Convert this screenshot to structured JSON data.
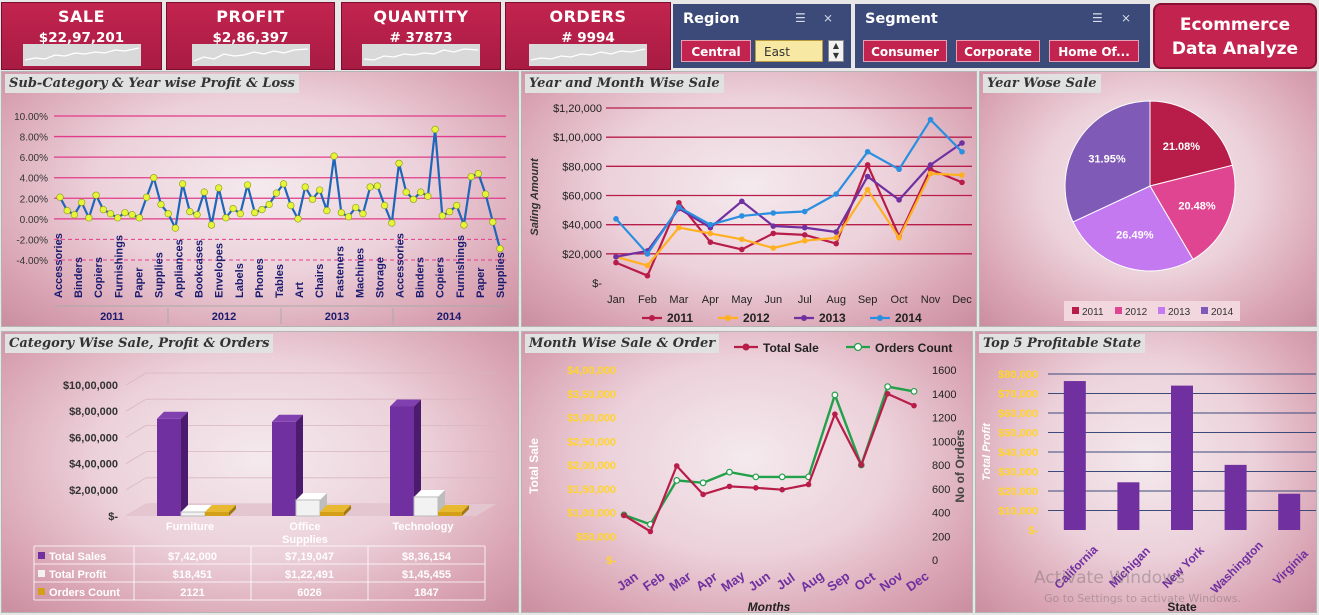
{
  "kpis": [
    {
      "title": "SALE",
      "value": "$22,97,201"
    },
    {
      "title": "PROFIT",
      "value": "$2,86,397"
    },
    {
      "title": "QUANTITY",
      "value": "# 37873"
    },
    {
      "title": "ORDERS",
      "value": "# 9994"
    }
  ],
  "region_slicer": {
    "title": "Region",
    "items": [
      "Central",
      "East"
    ],
    "selected": "Central"
  },
  "segment_slicer": {
    "title": "Segment",
    "items": [
      "Consumer",
      "Corporate",
      "Home Of..."
    ]
  },
  "dashboard_title": "Ecommerce Data Analyze",
  "panels": {
    "subcat": "Sub-Category & Year wise Profit & Loss",
    "yearmonth": "Year and Month Wise Sale",
    "yearpie": "Year Wose Sale",
    "category": "Category Wise Sale, Profit & Orders",
    "monthwise": "Month Wise Sale & Order",
    "top5": "Top 5 Profitable State"
  },
  "watermark": {
    "line1": "Activate Windows",
    "line2": "Go to Settings to activate Windows."
  },
  "colors": {
    "accent": "#c2244f",
    "slicer": "#3c4a7a",
    "purple": "#7030a0",
    "y2011": "#b81d4a",
    "y2012": "#ffb020",
    "y2013": "#7030a0",
    "y2014": "#2a8fe0"
  },
  "chart_data": [
    {
      "type": "line",
      "title": "Sub-Category & Year wise Profit & Loss",
      "ylim": [
        -0.04,
        0.1
      ],
      "yticks": [
        "10.00%",
        "8.00%",
        "6.00%",
        "4.00%",
        "2.00%",
        "0.00%",
        "-2.00%",
        "-4.00%"
      ],
      "x_labels": [
        "Accessories",
        "Binders",
        "Copiers",
        "Furnishings",
        "Paper",
        "Supplies",
        "Appliances",
        "Bookcases",
        "Envelopes",
        "Labels",
        "Phones",
        "Tables",
        "Art",
        "Chairs",
        "Fasteners",
        "Machines",
        "Storage",
        "Accessories",
        "Binders",
        "Copiers",
        "Furnishings",
        "Paper",
        "Supplies"
      ],
      "years": [
        "2011",
        "2012",
        "2013",
        "2014"
      ],
      "values": [
        0.021,
        0.008,
        0.004,
        0.016,
        0.001,
        0.023,
        0.009,
        0.005,
        0.001,
        0.006,
        0.004,
        0.001,
        0.021,
        0.04,
        0.014,
        0.005,
        -0.009,
        0.034,
        0.007,
        0.004,
        0.026,
        -0.006,
        0.03,
        0.001,
        0.01,
        0.005,
        0.033,
        0.006,
        0.009,
        0.014,
        0.025,
        0.034,
        0.013,
        0.0,
        0.031,
        0.019,
        0.028,
        0.008,
        0.061,
        0.006,
        0.002,
        0.011,
        0.005,
        0.031,
        0.032,
        0.013,
        -0.004,
        0.054,
        0.026,
        0.019,
        0.026,
        0.022,
        0.087,
        0.003,
        0.007,
        0.013,
        -0.006,
        0.041,
        0.044,
        0.024,
        -0.003,
        -0.029
      ]
    },
    {
      "type": "line",
      "title": "Year and Month Wise Sale",
      "ylabel": "Saling Amount",
      "ylim": [
        0,
        120000
      ],
      "yticks": [
        "$1,20,000",
        "$1,00,000",
        "$80,000",
        "$60,000",
        "$40,000",
        "$20,000",
        "$-"
      ],
      "categories": [
        "Jan",
        "Feb",
        "Mar",
        "Apr",
        "May",
        "Jun",
        "Jul",
        "Aug",
        "Sep",
        "Oct",
        "Nov",
        "Dec"
      ],
      "series": [
        {
          "name": "2011",
          "values": [
            14000,
            5000,
            55000,
            28000,
            23000,
            34000,
            33000,
            27000,
            81000,
            32000,
            78000,
            69000
          ]
        },
        {
          "name": "2012",
          "values": [
            18000,
            12000,
            38000,
            34000,
            30000,
            24000,
            29000,
            31000,
            64000,
            31000,
            75000,
            74000
          ]
        },
        {
          "name": "2013",
          "values": [
            18000,
            22000,
            51000,
            38000,
            56000,
            39000,
            38000,
            35000,
            73000,
            57000,
            81000,
            96000
          ]
        },
        {
          "name": "2014",
          "values": [
            44000,
            20000,
            52000,
            40000,
            46000,
            48000,
            49000,
            61000,
            90000,
            78000,
            112000,
            90000
          ]
        }
      ]
    },
    {
      "type": "pie",
      "title": "Year Wose Sale",
      "labels": [
        "2011",
        "2012",
        "2013",
        "2014"
      ],
      "values": [
        21.08,
        20.48,
        26.49,
        31.95
      ],
      "value_labels": [
        "21.08%",
        "20.48%",
        "26.49%",
        "31.95%"
      ],
      "colors": [
        "#b81d4a",
        "#df4590",
        "#c579f0",
        "#7f5ab6"
      ]
    },
    {
      "type": "bar",
      "title": "Category Wise Sale, Profit & Orders",
      "categories": [
        "Furniture",
        "Office Supplies",
        "Technology"
      ],
      "ylim": [
        0,
        1000000
      ],
      "yticks": [
        "$10,00,000",
        "$8,00,000",
        "$6,00,000",
        "$4,00,000",
        "$2,00,000",
        "$-"
      ],
      "series": [
        {
          "name": "Total Sales",
          "values": [
            742000,
            719047,
            836154
          ],
          "labels": [
            "$7,42,000",
            "$7,19,047",
            "$8,36,154"
          ],
          "color": "#7030a0"
        },
        {
          "name": "Total Profit",
          "values": [
            18451,
            122491,
            145455
          ],
          "labels": [
            "$18,451",
            "$1,22,491",
            "$1,45,455"
          ],
          "color": "#f2f2f2"
        },
        {
          "name": "Orders Count",
          "values": [
            2121,
            6026,
            1847
          ],
          "labels": [
            "2121",
            "6026",
            "1847"
          ],
          "color": "#d4a017"
        }
      ]
    },
    {
      "type": "line",
      "title": "Month Wise Sale & Order",
      "xlabel": "Months",
      "ylabel": "Total Sale",
      "y2label": "No of Orders",
      "ylim": [
        0,
        400000
      ],
      "y2lim": [
        0,
        1600
      ],
      "yticks": [
        "$4,00,000",
        "$3,50,000",
        "$3,00,000",
        "$2,50,000",
        "$2,00,000",
        "$1,50,000",
        "$1,00,000",
        "$50,000",
        "$-"
      ],
      "y2ticks": [
        "1600",
        "1400",
        "1200",
        "1000",
        "800",
        "600",
        "400",
        "200",
        "0"
      ],
      "categories": [
        "Jan",
        "Feb",
        "Mar",
        "Apr",
        "May",
        "Jun",
        "Jul",
        "Aug",
        "Sep",
        "Oct",
        "Nov",
        "Dec"
      ],
      "series": [
        {
          "name": "Total Sale",
          "values": [
            94000,
            60000,
            198000,
            138000,
            155000,
            152000,
            148000,
            159000,
            307000,
            200000,
            350000,
            325000
          ],
          "color": "#b81d4a"
        },
        {
          "name": "Orders Count",
          "values": [
            380,
            300,
            670,
            650,
            740,
            700,
            700,
            700,
            1390,
            800,
            1460,
            1420
          ],
          "color": "#22a04a"
        }
      ]
    },
    {
      "type": "bar",
      "title": "Top 5 Profitable State",
      "xlabel": "State",
      "ylabel": "Total Profit",
      "ylim": [
        0,
        80000
      ],
      "yticks": [
        "$80,000",
        "$70,000",
        "$60,000",
        "$50,000",
        "$40,000",
        "$30,000",
        "$20,000",
        "$10,000",
        "$-"
      ],
      "categories": [
        "California",
        "Michigan",
        "New York",
        "Washington",
        "Virginia"
      ],
      "values": [
        76381,
        24463,
        74039,
        33403,
        18598
      ]
    }
  ]
}
